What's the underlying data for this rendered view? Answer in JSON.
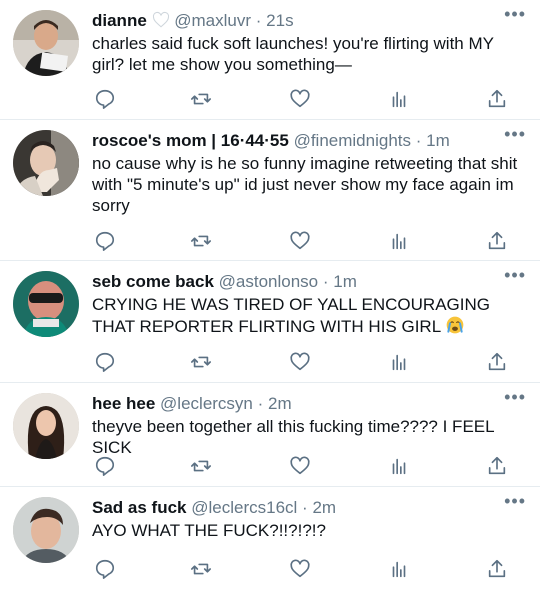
{
  "tweets": [
    {
      "name": "dianne",
      "name_icon": "white-heart-icon",
      "handle": "@maxluvr",
      "time": "21s",
      "text": "charles said fuck soft launches! you're flirting with MY girl? let me show you something—"
    },
    {
      "name": "roscoe's mom | 16·44·55",
      "handle": "@finemidnights",
      "time": "1m",
      "text": "no cause why is he so funny imagine retweeting that shit with \"5 minute's up\" id just never show my face again im sorry"
    },
    {
      "name": "seb come back",
      "handle": "@astonlonso",
      "time": "1m",
      "text": "CRYING HE WAS TIRED OF YALL ENCOURAGING THAT REPORTER FLIRTING WITH HIS GIRL",
      "text_icon": "crying-face-emoji"
    },
    {
      "name": "hee hee",
      "handle": "@leclercsyn",
      "time": "2m",
      "text": "theyve been together all this fucking time???? I FEEL SICK"
    },
    {
      "name": "Sad as fuck",
      "handle": "@leclercs16cl",
      "time": "2m",
      "text": "AYO WHAT THE FUCK?!!?!?!?"
    }
  ],
  "more_label": "•••",
  "separator": "·",
  "colors": {
    "text": "#0f1419",
    "secondary": "#657786",
    "divider": "#e6ecf0",
    "icon": "#5b7083"
  }
}
